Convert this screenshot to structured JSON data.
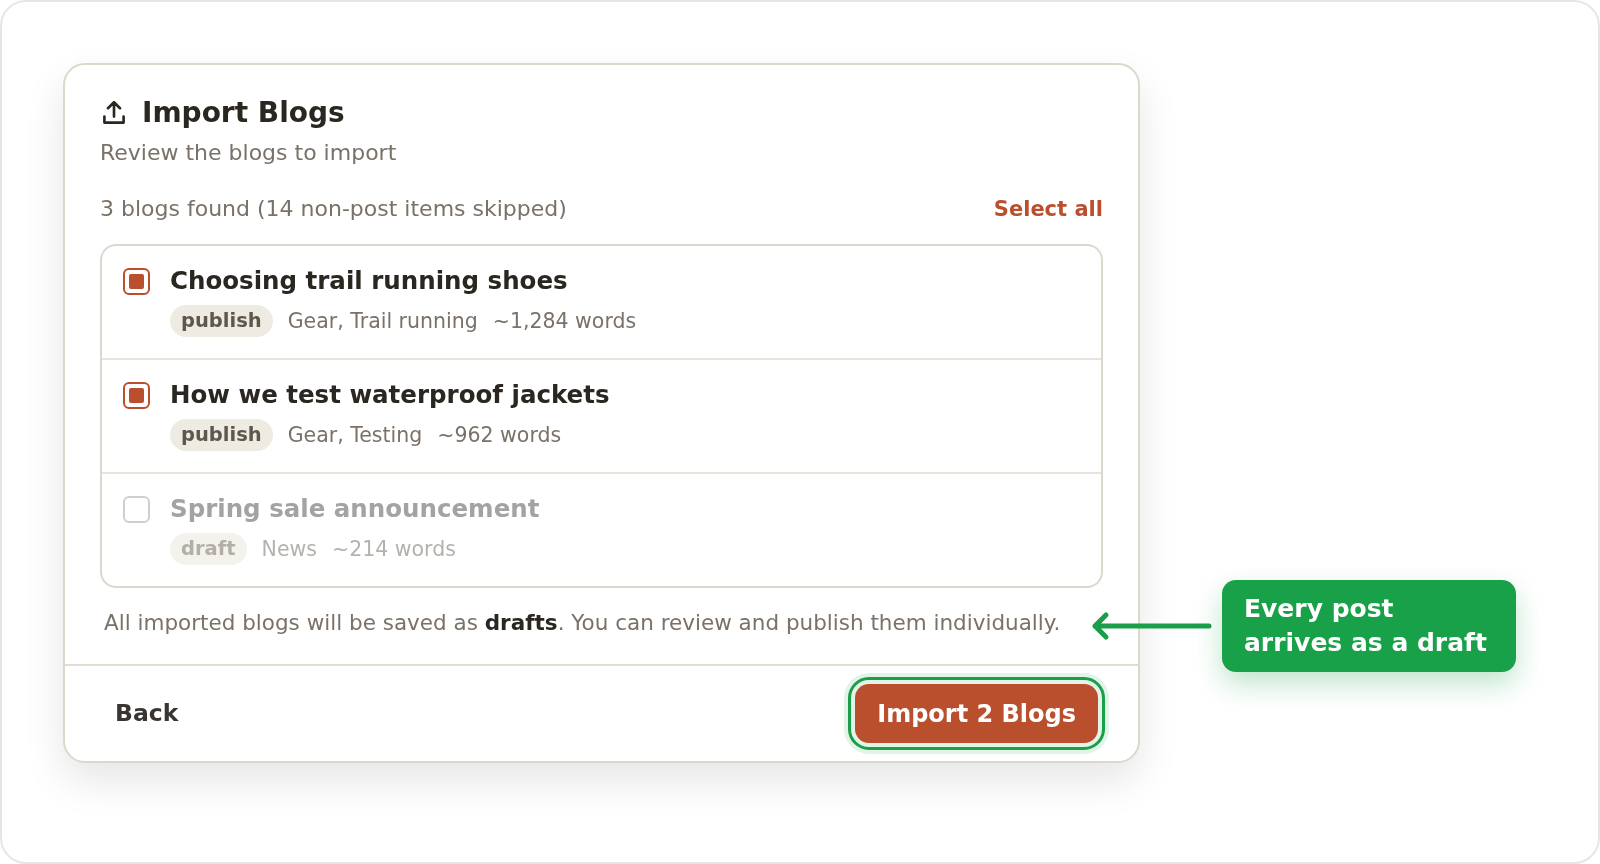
{
  "dialog": {
    "title": "Import Blogs",
    "subtitle": "Review the blogs to import",
    "summary": "3 blogs found (14 non-post items skipped)",
    "select_all": "Select all",
    "blogs": [
      {
        "title": "Choosing trail running shoes",
        "status": "publish",
        "tags": "Gear, Trail running",
        "words": "~1,284 words",
        "checked": true
      },
      {
        "title": "How we test waterproof jackets",
        "status": "publish",
        "tags": "Gear, Testing",
        "words": "~962 words",
        "checked": true
      },
      {
        "title": "Spring sale announcement",
        "status": "draft",
        "tags": "News",
        "words": "~214 words",
        "checked": false
      }
    ],
    "note": "All imported blogs will be saved as **drafts**. You can review and publish them individually.",
    "back_button": "Back",
    "import_button": {
      "label": "Import 2 Blogs",
      "highlighted": true
    }
  },
  "callout": {
    "text": "Every post arrives as a draft"
  }
}
